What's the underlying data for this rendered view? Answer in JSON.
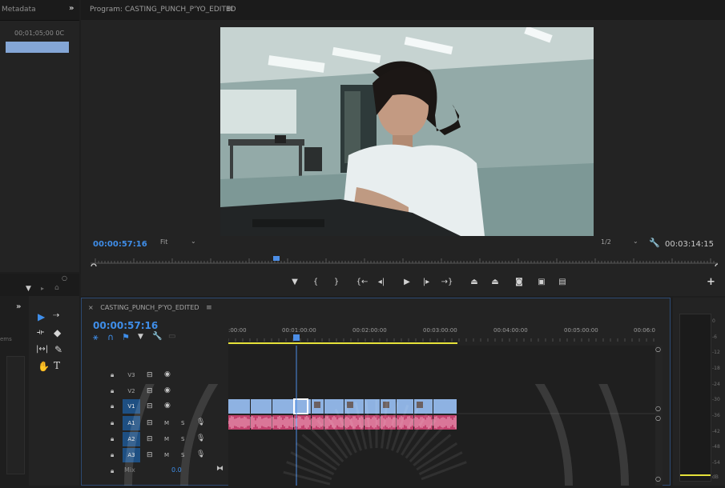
{
  "metadata_panel": {
    "title": "Metadata",
    "expand_icon": "double-chevron-right-icon",
    "timecode": "00;01;05;00  0C"
  },
  "program_monitor": {
    "title": "Program: CASTING_PUNCH_P'YO_EDITED",
    "menu_icon": "hamburger-icon",
    "current_timecode": "00:00:57:16",
    "zoom_select": "Fit",
    "resolution_select": "1/2",
    "duration": "00:03:14:15",
    "controls": [
      "add-marker-icon",
      "mark-in-icon",
      "mark-out-icon",
      "go-to-in-icon",
      "step-back-icon",
      "play-icon",
      "step-forward-icon",
      "go-to-out-icon",
      "lift-icon",
      "extract-icon",
      "export-frame-icon",
      "comparison-view-icon",
      "multi-camera-icon"
    ],
    "add_button": "+"
  },
  "tools_panel": {
    "expand_icon": "double-chevron-right-icon",
    "items_label": "ems",
    "tools": [
      "selection-tool-icon",
      "track-select-tool-icon",
      "ripple-edit-tool-icon",
      "razor-tool-icon",
      "slip-tool-icon",
      "pen-tool-icon",
      "hand-tool-icon",
      "type-tool-icon"
    ],
    "type_tool_glyph": "T"
  },
  "timeline": {
    "close_icon": "×",
    "sequence_name": "CASTING_PUNCH_P'YO_EDITED",
    "menu_icon": "≡",
    "timecode": "00:00:57:16",
    "ruler_labels": [
      ":00:00",
      "00:01:00:00",
      "00:02:00:00",
      "00:03:00:00",
      "00:04:00:00",
      "00:05:00:00",
      "00:06:0"
    ],
    "playhead_position_seconds": 57.67,
    "tracks": [
      {
        "name": "V3",
        "type": "video",
        "selected": false
      },
      {
        "name": "V2",
        "type": "video",
        "selected": false
      },
      {
        "name": "V1",
        "type": "video",
        "selected": true
      },
      {
        "name": "A1",
        "type": "audio",
        "selected": true
      },
      {
        "name": "A2",
        "type": "audio",
        "selected": true
      },
      {
        "name": "A3",
        "type": "audio",
        "selected": true
      }
    ],
    "mix_label": "Mix",
    "mix_value": "0.0",
    "mute_label": "M",
    "solo_label": "S",
    "video_clip_color": "#8eb2e2",
    "audio_clip_color": "#c2426e"
  },
  "audio_meter": {
    "db_labels": [
      "0",
      "-6",
      "-12",
      "-18",
      "-24",
      "-30",
      "-36",
      "-42",
      "-48",
      "-54",
      "dB"
    ]
  },
  "colors": {
    "accent_blue": "#3f8ee9",
    "playhead_blue": "#4c8ee6",
    "in_out_yellow": "#e6e23a"
  }
}
